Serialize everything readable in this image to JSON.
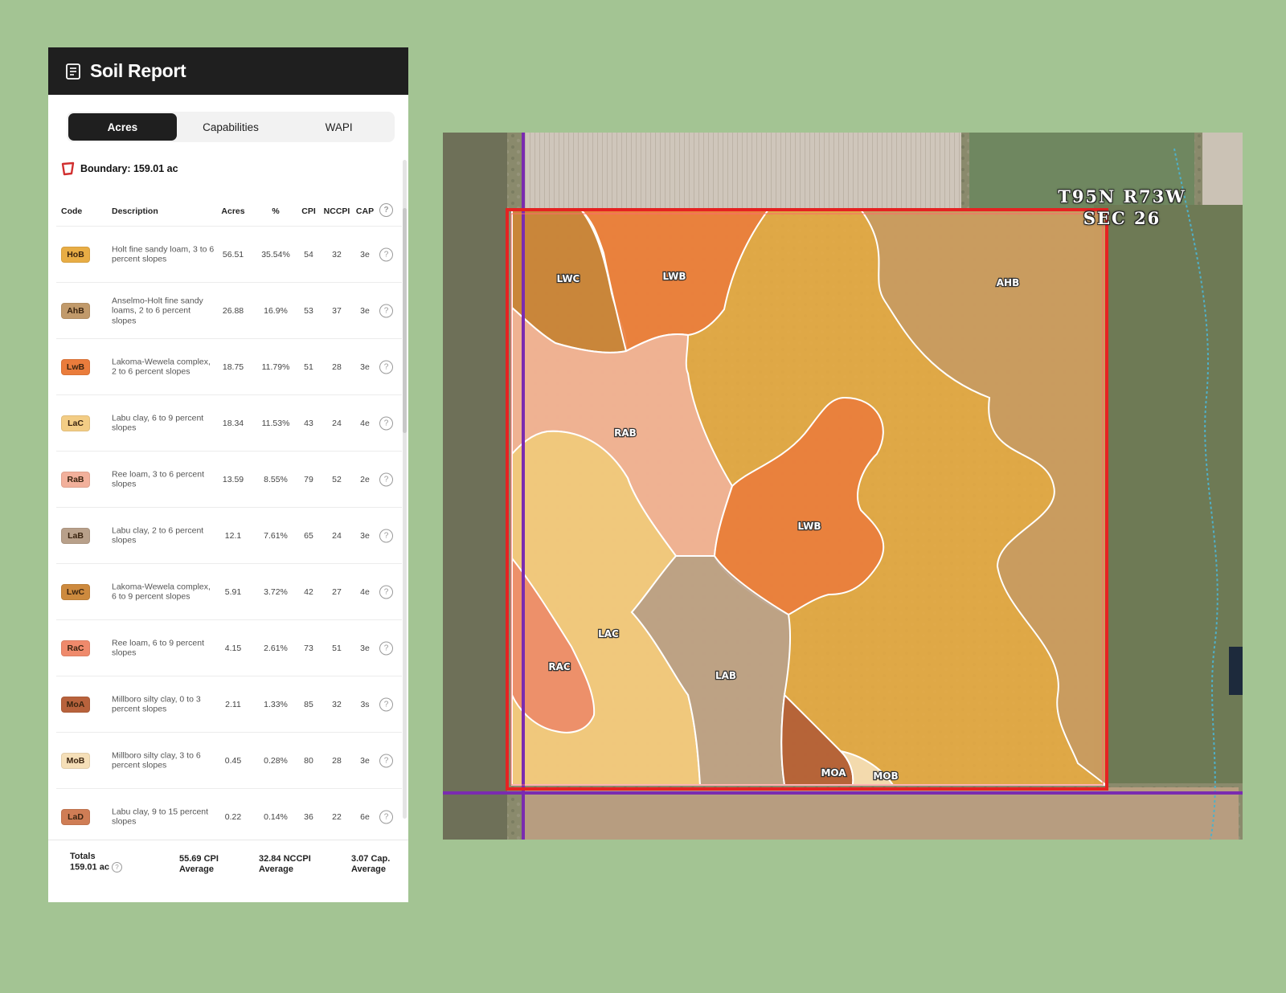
{
  "header": {
    "title": "Soil Report",
    "icon": "report-icon"
  },
  "tabs": [
    {
      "label": "Acres",
      "active": true
    },
    {
      "label": "Capabilities",
      "active": false
    },
    {
      "label": "WAPI",
      "active": false
    }
  ],
  "boundary": {
    "label": "Boundary: 159.01 ac",
    "color": "#d12f2f"
  },
  "table": {
    "headers": {
      "code": "Code",
      "description": "Description",
      "acres": "Acres",
      "pct": "%",
      "cpi": "CPI",
      "nccpi": "NCCPI",
      "cap": "CAP"
    },
    "rows": [
      {
        "code": "HoB",
        "color": "#e8ad45",
        "description": "Holt fine sandy loam, 3 to 6 percent slopes",
        "acres": "56.51",
        "pct": "35.54%",
        "cpi": "54",
        "nccpi": "32",
        "cap": "3e"
      },
      {
        "code": "AhB",
        "color": "#c19a6b",
        "description": "Anselmo-Holt fine sandy loams, 2 to 6 percent slopes",
        "acres": "26.88",
        "pct": "16.9%",
        "cpi": "53",
        "nccpi": "37",
        "cap": "3e"
      },
      {
        "code": "LwB",
        "color": "#ea7c3c",
        "description": "Lakoma-Wewela complex, 2 to 6 percent slopes",
        "acres": "18.75",
        "pct": "11.79%",
        "cpi": "51",
        "nccpi": "28",
        "cap": "3e"
      },
      {
        "code": "LaC",
        "color": "#f3cd85",
        "description": "Labu clay, 6 to 9 percent slopes",
        "acres": "18.34",
        "pct": "11.53%",
        "cpi": "43",
        "nccpi": "24",
        "cap": "4e"
      },
      {
        "code": "RaB",
        "color": "#f2b09b",
        "description": "Ree loam, 3 to 6 percent slopes",
        "acres": "13.59",
        "pct": "8.55%",
        "cpi": "79",
        "nccpi": "52",
        "cap": "2e"
      },
      {
        "code": "LaB",
        "color": "#b8a08a",
        "description": "Labu clay, 2 to 6 percent slopes",
        "acres": "12.1",
        "pct": "7.61%",
        "cpi": "65",
        "nccpi": "24",
        "cap": "3e"
      },
      {
        "code": "LwC",
        "color": "#cd8a3e",
        "description": "Lakoma-Wewela complex, 6 to 9 percent slopes",
        "acres": "5.91",
        "pct": "3.72%",
        "cpi": "42",
        "nccpi": "27",
        "cap": "4e"
      },
      {
        "code": "RaC",
        "color": "#ef8a6c",
        "description": "Ree loam, 6 to 9 percent slopes",
        "acres": "4.15",
        "pct": "2.61%",
        "cpi": "73",
        "nccpi": "51",
        "cap": "3e"
      },
      {
        "code": "MoA",
        "color": "#b8623c",
        "description": "Millboro silty clay, 0 to 3 percent slopes",
        "acres": "2.11",
        "pct": "1.33%",
        "cpi": "85",
        "nccpi": "32",
        "cap": "3s"
      },
      {
        "code": "MoB",
        "color": "#f5dfb8",
        "description": "Millboro silty clay, 3 to 6 percent slopes",
        "acres": "0.45",
        "pct": "0.28%",
        "cpi": "80",
        "nccpi": "28",
        "cap": "3e"
      },
      {
        "code": "LaD",
        "color": "#cf7d55",
        "description": "Labu clay, 9 to 15 percent slopes",
        "acres": "0.22",
        "pct": "0.14%",
        "cpi": "36",
        "nccpi": "22",
        "cap": "6e"
      }
    ]
  },
  "totals": {
    "label": "Totals",
    "acres": "159.01 ac",
    "cpi_value": "55.69 CPI",
    "cpi_label": "Average",
    "nccpi_value": "32.84 NCCPI",
    "nccpi_label": "Average",
    "cap_value": "3.07 Cap.",
    "cap_label": "Average"
  },
  "map": {
    "section_label_line1": "T95N R73W",
    "section_label_line2": "SEC 26",
    "zones": [
      "LWC",
      "LWB",
      "AHB",
      "RAB",
      "LWB",
      "LAC",
      "RAC",
      "LAB",
      "MOA",
      "MOB"
    ],
    "boundary_color": "#e52222",
    "section_line_color": "#7a2bb0"
  }
}
